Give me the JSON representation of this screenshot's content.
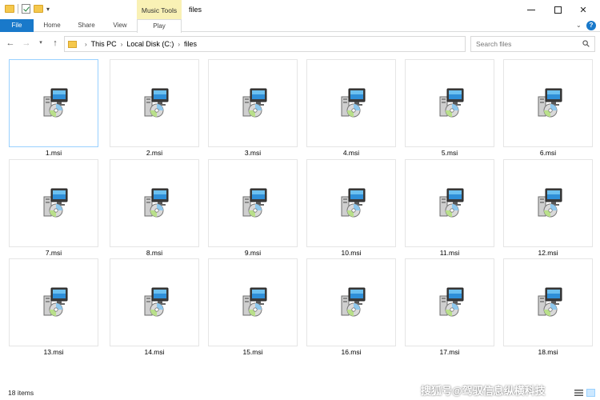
{
  "titlebar": {
    "title": "files",
    "context_tab_group": "Music Tools",
    "quick_access_icons": [
      "folder-icon",
      "properties-check-icon",
      "new-folder-icon",
      "customize-caret-icon"
    ],
    "controls": [
      "minimize-icon",
      "maximize-icon",
      "close-icon"
    ]
  },
  "ribbon": {
    "tabs": [
      {
        "id": "file",
        "label": "File"
      },
      {
        "id": "home",
        "label": "Home"
      },
      {
        "id": "share",
        "label": "Share"
      },
      {
        "id": "view",
        "label": "View"
      },
      {
        "id": "play",
        "label": "Play"
      }
    ]
  },
  "address": {
    "breadcrumb": [
      "This PC",
      "Local Disk (C:)",
      "files"
    ],
    "search_placeholder": "Search files"
  },
  "files": [
    {
      "name": "1.msi",
      "selected": true
    },
    {
      "name": "2.msi"
    },
    {
      "name": "3.msi"
    },
    {
      "name": "4.msi"
    },
    {
      "name": "5.msi"
    },
    {
      "name": "6.msi"
    },
    {
      "name": "7.msi"
    },
    {
      "name": "8.msi"
    },
    {
      "name": "9.msi"
    },
    {
      "name": "10.msi"
    },
    {
      "name": "11.msi"
    },
    {
      "name": "12.msi"
    },
    {
      "name": "13.msi"
    },
    {
      "name": "14.msi"
    },
    {
      "name": "15.msi"
    },
    {
      "name": "16.msi"
    },
    {
      "name": "17.msi"
    },
    {
      "name": "18.msi"
    }
  ],
  "status": {
    "item_count": "18 items"
  },
  "watermark": "搜狐号@驾驭信息纵横科技",
  "colors": {
    "file_tab": "#1979ca",
    "context_tab": "#f9f1b5",
    "selected_border": "#99d1ff"
  }
}
